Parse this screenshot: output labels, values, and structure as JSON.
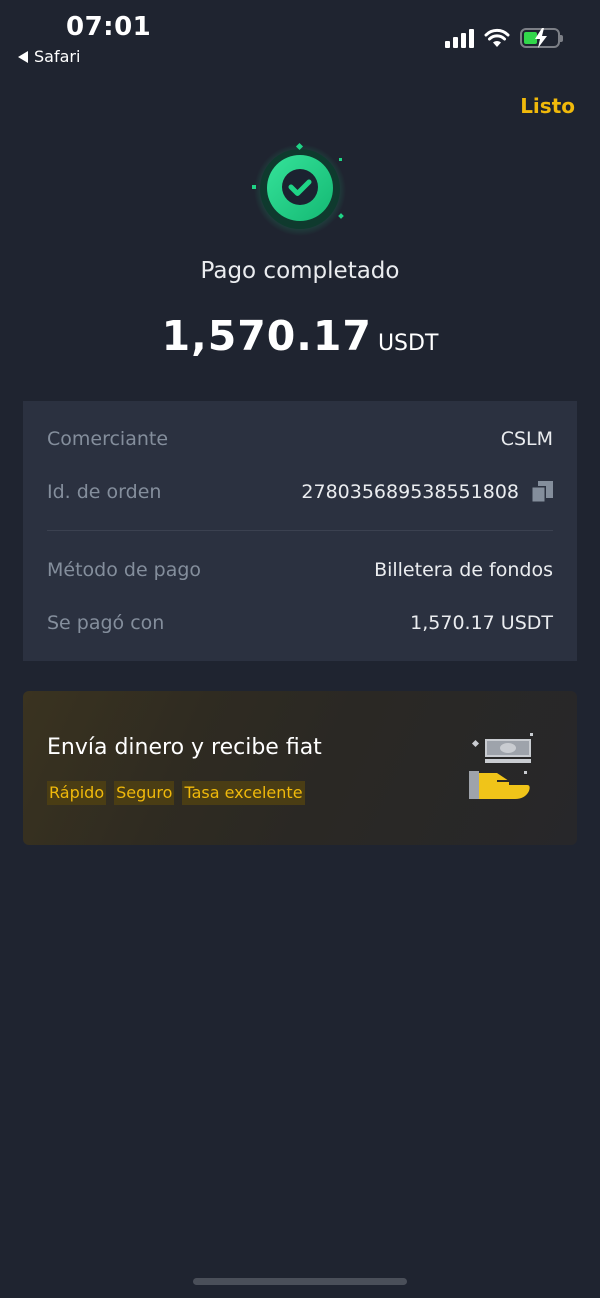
{
  "status_bar": {
    "time": "07:01",
    "back_label": "Safari",
    "icons": [
      "signal-icon",
      "wifi-icon",
      "battery-charging-icon"
    ]
  },
  "header": {
    "done_label": "Listo"
  },
  "payment": {
    "status_title": "Pago completado",
    "amount": "1,570.17",
    "currency": "USDT"
  },
  "details": {
    "rows_top": [
      {
        "label": "Comerciante",
        "value": "CSLM"
      },
      {
        "label": "Id. de orden",
        "value": "278035689538551808"
      }
    ],
    "rows_bottom": [
      {
        "label": "Método de pago",
        "value": "Billetera de fondos"
      },
      {
        "label": "Se pagó con",
        "value": "1,570.17 USDT"
      }
    ]
  },
  "promo": {
    "title": "Envía dinero y recibe fiat",
    "tags": [
      "Rápido",
      "Seguro",
      "Tasa excelente"
    ]
  },
  "colors": {
    "background": "#1f2430",
    "card": "#2b3140",
    "accent": "#f0b90b",
    "success": "#1fd486"
  }
}
